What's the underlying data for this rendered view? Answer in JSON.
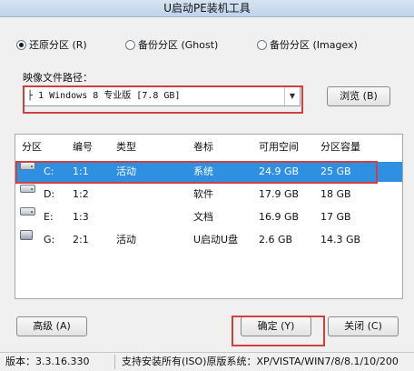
{
  "window": {
    "title": "U启动PE装机工具"
  },
  "modes": [
    {
      "label": "还原分区 (R)",
      "selected": true
    },
    {
      "label": "备份分区 (Ghost)",
      "selected": false
    },
    {
      "label": "备份分区 (Imagex)",
      "selected": false
    }
  ],
  "image_path": {
    "label": "映像文件路径：",
    "value": "├ 1 Windows 8 专业版 [7.8 GB]",
    "browse_label": "浏览 (B)"
  },
  "table": {
    "columns": [
      "分区",
      "编号",
      "类型",
      "卷标",
      "可用空间",
      "分区容量"
    ],
    "rows": [
      {
        "drive": "C:",
        "num": "1:1",
        "type": "活动",
        "label": "系统",
        "free": "24.9 GB",
        "size": "25 GB",
        "icon": "hard-disk-icon",
        "selected": true
      },
      {
        "drive": "D:",
        "num": "1:2",
        "type": "",
        "label": "软件",
        "free": "17.9 GB",
        "size": "18 GB",
        "icon": "hard-disk-icon",
        "selected": false
      },
      {
        "drive": "E:",
        "num": "1:3",
        "type": "",
        "label": "文档",
        "free": "16.9 GB",
        "size": "17 GB",
        "icon": "hard-disk-icon",
        "selected": false
      },
      {
        "drive": "G:",
        "num": "2:1",
        "type": "活动",
        "label": "U启动U盘",
        "free": "2.6 GB",
        "size": "14.3 GB",
        "icon": "usb-drive-icon",
        "selected": false
      }
    ]
  },
  "buttons": {
    "advanced": "高级 (A)",
    "ok": "确定 (Y)",
    "close": "关闭 (C)"
  },
  "status": {
    "version": "版本：3.3.16.330",
    "support": "支持安装所有(ISO)原版系统：XP/VISTA/WIN7/8/8.1/10/200"
  },
  "colors": {
    "selection": "#2f8fe0",
    "highlight_box": "#d0413d"
  }
}
